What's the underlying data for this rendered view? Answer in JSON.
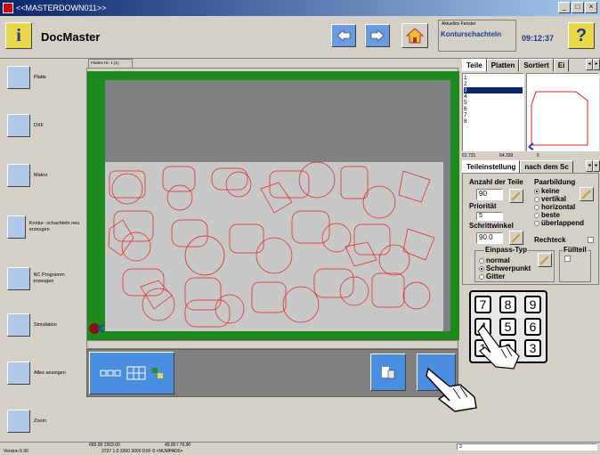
{
  "window": {
    "title": "<<MASTERDOWN011>>"
  },
  "app": {
    "name": "DocMaster",
    "logo_glyph": "i"
  },
  "window_info": {
    "label": "Aktuelles Fenster",
    "value": "Konturschachteln"
  },
  "clock": "09:12:37",
  "help_glyph": "?",
  "sidebar": {
    "items": [
      {
        "label": "Platte",
        "icon": "plate-icon"
      },
      {
        "label": "DXF",
        "icon": "dxf-icon"
      },
      {
        "label": "Makro",
        "icon": "macro-icon"
      },
      {
        "label": "Kontur- schachteln neu erzeugen",
        "icon": "nesting-icon"
      },
      {
        "label": "NC Programm erzeugen",
        "icon": "nc-program-icon"
      },
      {
        "label": "Simulation",
        "icon": "simulation-icon"
      },
      {
        "label": "Alles anzeigen",
        "icon": "show-all-icon"
      },
      {
        "label": "Zoom",
        "icon": "zoom-icon"
      }
    ]
  },
  "canvas": {
    "tab": "Platten Nr. 1 (1)"
  },
  "right": {
    "tabs": [
      "Teile",
      "Platten",
      "Sortiert",
      "Ei"
    ],
    "parts_list": [
      "1",
      "2",
      "3",
      "4",
      "5",
      "6",
      "7",
      "8"
    ],
    "selected_part": "3",
    "dim_x": "61.731",
    "dim_y": "64.339",
    "dim_n": "6",
    "subtabs": [
      "Teileinstellung",
      "nach dem Sc"
    ],
    "anzahl_label": "Anzahl der Teile",
    "anzahl_value": "90",
    "prioritaet_label": "Priorität",
    "prioritaet_value": "5",
    "schrittwinkel_label": "Schrittwinkel",
    "schrittwinkel_value": "90.0",
    "paarbildung_label": "Paarbildung",
    "paarbildung_options": [
      "keine",
      "vertikal",
      "horizontal",
      "beste",
      "überlappend"
    ],
    "rechteck_label": "Rechteck",
    "einpass_label": "Einpass-Typ",
    "einpass_options": [
      "normal",
      "Schwerpunkt",
      "Gitter"
    ],
    "fuellteil_label": "Füllteil"
  },
  "keypad": [
    "7",
    "8",
    "9",
    "4",
    "5",
    "6",
    "1",
    "2",
    "3"
  ],
  "bottom_status": {
    "coords": "665.00  1563.00",
    "dims": "45.80 / 76.90",
    "row2": "3737   1.0   2000   3000   DXF   8   <NUMPAD0>",
    "version": "Version 6.90",
    "field": "3"
  }
}
